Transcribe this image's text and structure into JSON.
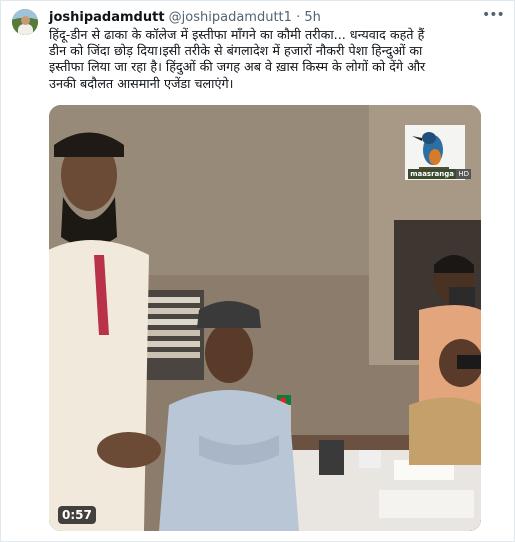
{
  "tweet": {
    "display_name": "joshipadamdutt",
    "handle": "@joshipadamdutt1",
    "separator": "·",
    "time": "5h",
    "more_icon": "more-horizontal-icon",
    "text": "हिंदू-डीन से ढाका के कॉलेज में इस्तीफा माँगने का कौमी तरीका... धन्यवाद कहते हैं\nडीन को जिंदा छोड़ दिया।इसी तरीके से बंगलादेश में हजारों नौकरी पेशा हिन्दुओं का\nइस्तीफा लिया जा रहा है। हिंदुओं की जगह अब वे ख़ास किस्म के लोगों को देंगे और\nउनकी बदौलत आसमानी एजेंडा चलाएंगे।"
  },
  "video": {
    "duration": "0:57",
    "watermark_text": "maasranga",
    "watermark_badge": "HD"
  }
}
